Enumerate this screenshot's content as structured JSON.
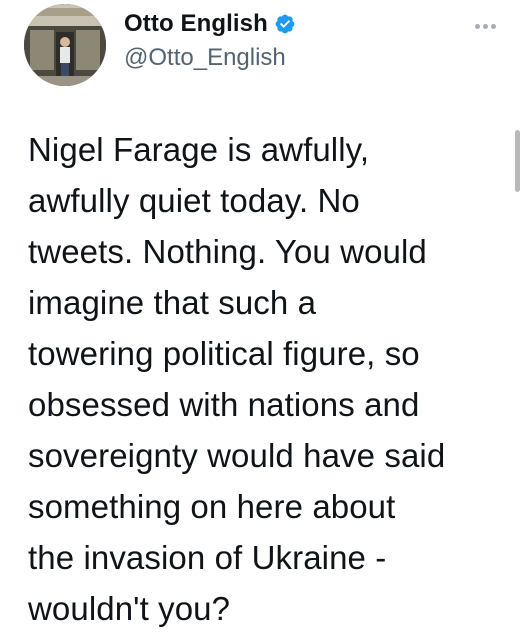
{
  "tweet": {
    "author": {
      "display_name": "Otto English",
      "handle": "@Otto_English",
      "verified": true,
      "avatar": "profile-photo"
    },
    "more_icon": "more-horizontal-icon",
    "text": "Nigel Farage is awfully,\nawfully quiet today. No\ntweets. Nothing. You would\nimagine that such a\ntowering political figure, so\nobsessed with nations and\nsovereignty would have said\nsomething on here about\nthe invasion of Ukraine -\nwouldn't you?"
  },
  "colors": {
    "text": "#0f1419",
    "secondary_text": "#536471",
    "verified_badge": "#1d9bf0",
    "background": "#ffffff"
  }
}
